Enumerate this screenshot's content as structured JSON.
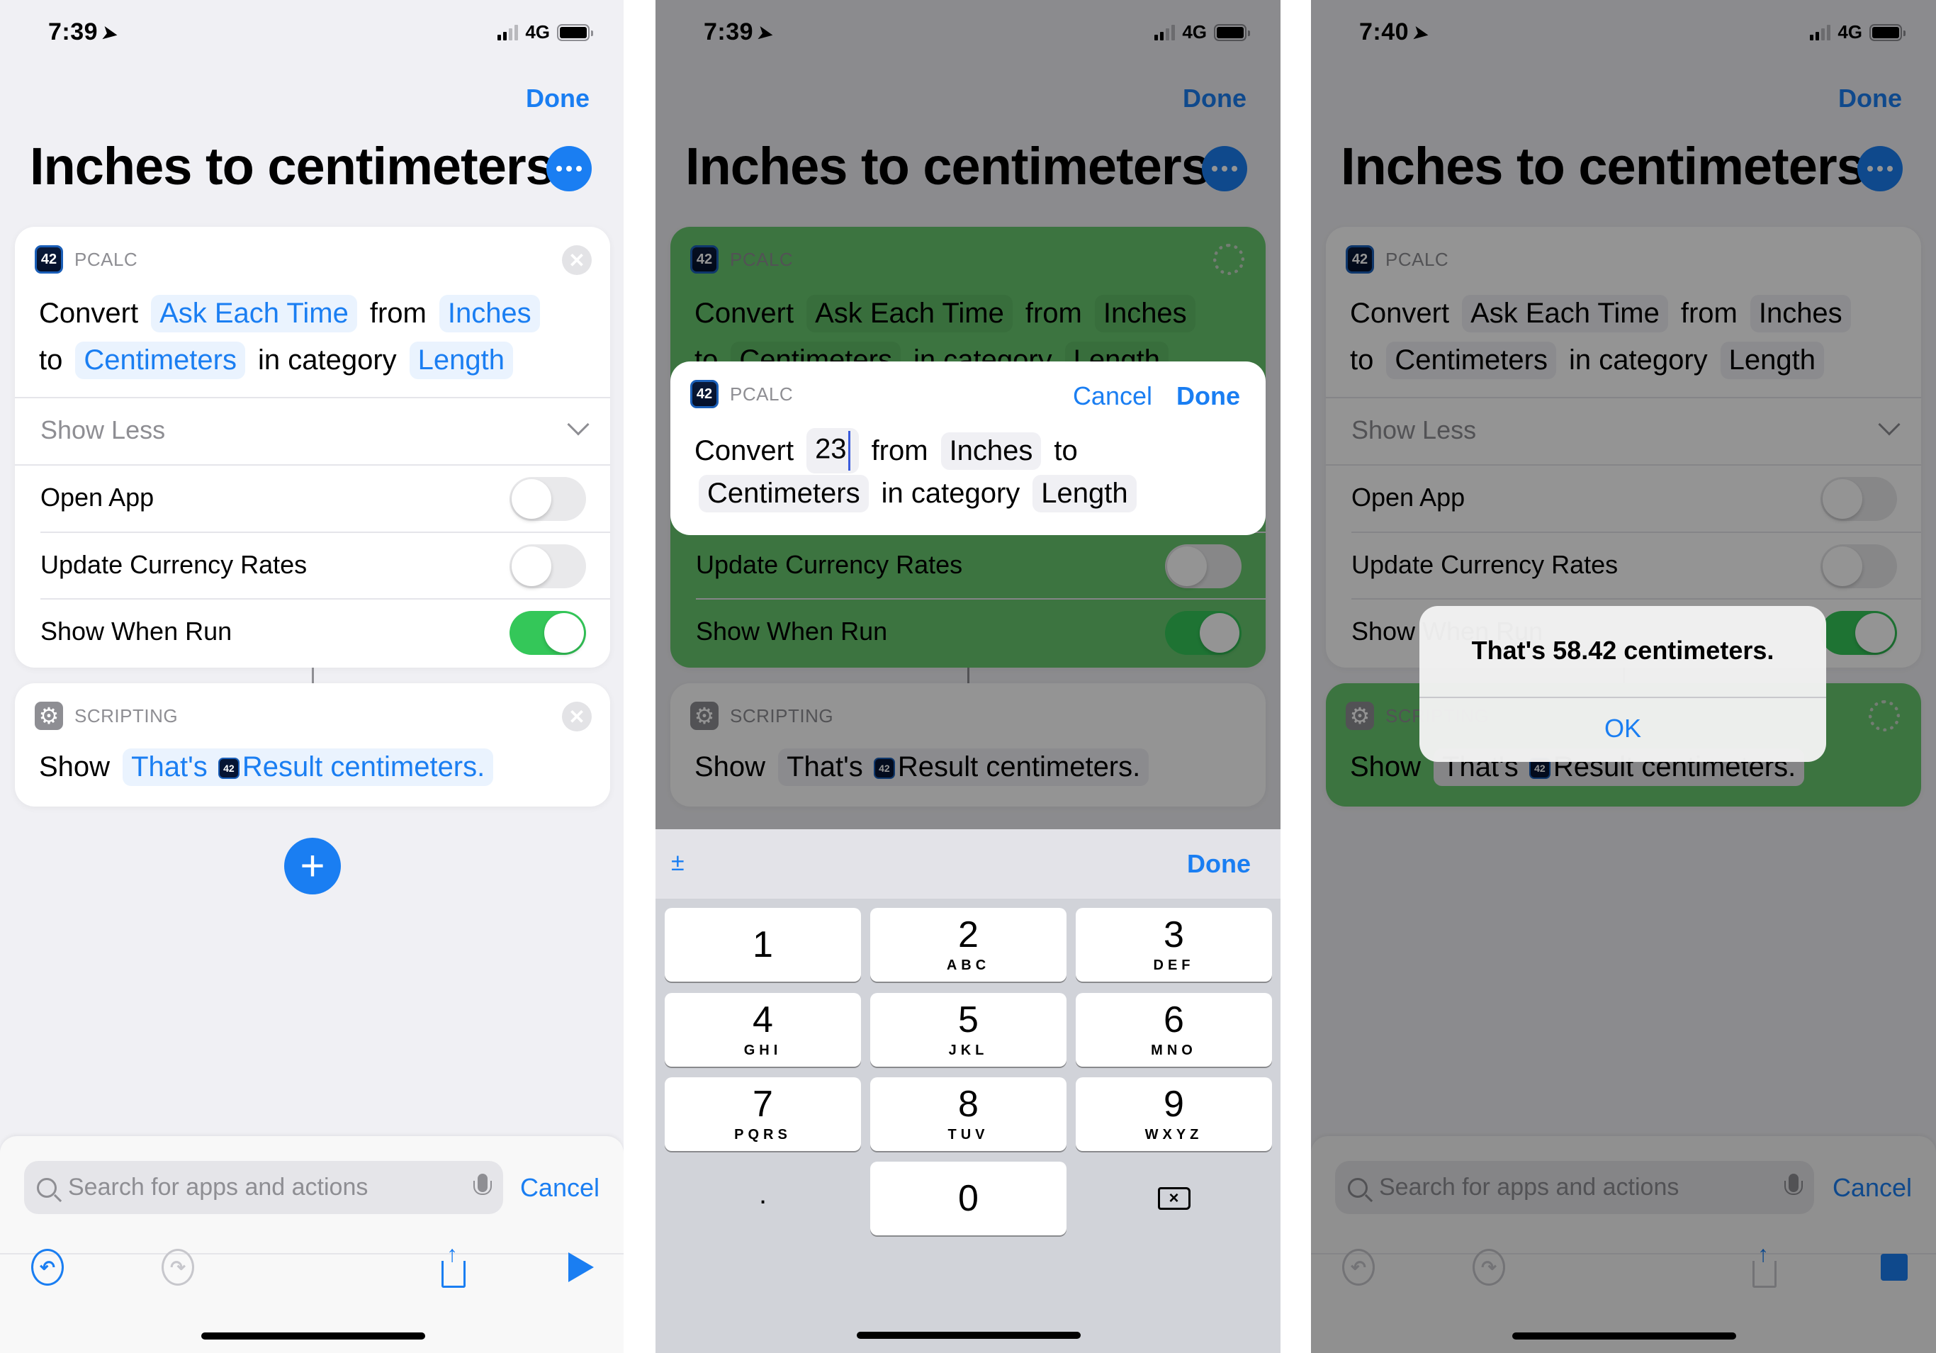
{
  "panels": [
    {
      "status": {
        "time": "7:39",
        "network": "4G"
      },
      "nav": {
        "done_label": "Done"
      },
      "title": "Inches to centimeters",
      "action1": {
        "app": "PCALC",
        "icon_text": "42",
        "line1": {
          "w1": "Convert",
          "t1": "Ask Each Time",
          "w2": "from",
          "t2": "Inches"
        },
        "line2": {
          "w1": "to",
          "t1": "Centimeters",
          "w2": "in category",
          "t2": "Length"
        },
        "show_less": "Show Less",
        "options": [
          {
            "label": "Open App",
            "on": false
          },
          {
            "label": "Update Currency Rates",
            "on": false
          },
          {
            "label": "Show When Run",
            "on": true
          }
        ]
      },
      "action2": {
        "app": "SCRIPTING",
        "verb": "Show",
        "text_before": "That's",
        "variable": "Result",
        "text_after": "centimeters."
      },
      "search": {
        "placeholder": "Search for apps and actions",
        "cancel_label": "Cancel"
      }
    },
    {
      "status": {
        "time": "7:39",
        "network": "4G"
      },
      "nav": {
        "done_label": "Done"
      },
      "title": "Inches to centimeters",
      "state": "running",
      "editor": {
        "app": "PCALC",
        "cancel_label": "Cancel",
        "done_label": "Done",
        "line1": {
          "w1": "Convert",
          "value": "23",
          "w2": "from",
          "t2": "Inches",
          "w3": "to"
        },
        "line2": {
          "t1": "Centimeters",
          "w1": "in category",
          "t2": "Length"
        }
      },
      "keyboard": {
        "plusminus_label": "±",
        "done_label": "Done",
        "keys": [
          {
            "num": "1",
            "letters": ""
          },
          {
            "num": "2",
            "letters": "ABC"
          },
          {
            "num": "3",
            "letters": "DEF"
          },
          {
            "num": "4",
            "letters": "GHI"
          },
          {
            "num": "5",
            "letters": "JKL"
          },
          {
            "num": "6",
            "letters": "MNO"
          },
          {
            "num": "7",
            "letters": "PQRS"
          },
          {
            "num": "8",
            "letters": "TUV"
          },
          {
            "num": "9",
            "letters": "WXYZ"
          },
          {
            "num": ".",
            "letters": ""
          },
          {
            "num": "0",
            "letters": ""
          }
        ]
      }
    },
    {
      "status": {
        "time": "7:40",
        "network": "4G"
      },
      "nav": {
        "done_label": "Done"
      },
      "title": "Inches to centimeters",
      "state": "running",
      "alert": {
        "message": "That's 58.42 centimeters.",
        "ok_label": "OK"
      },
      "search": {
        "placeholder": "Search for apps and actions",
        "cancel_label": "Cancel"
      }
    }
  ],
  "colors": {
    "accent": "#1a7ef2",
    "toggle_on": "#34c759",
    "running_card": "#68c96f",
    "background": "#f0f0f4"
  }
}
